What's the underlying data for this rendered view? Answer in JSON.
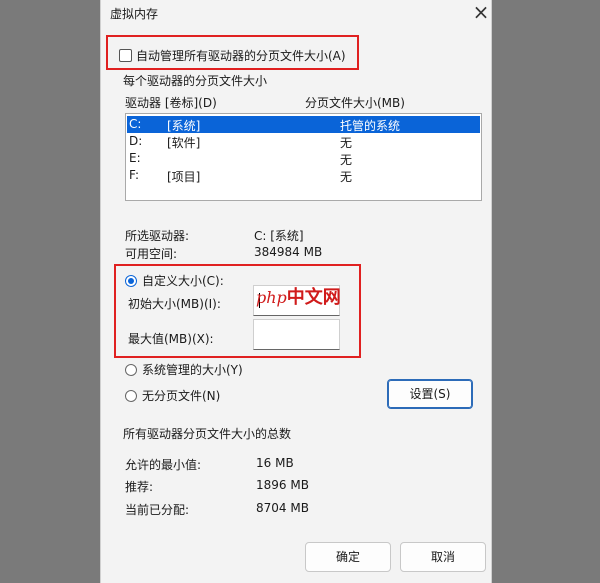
{
  "window": {
    "title": "虚拟内存"
  },
  "auto_manage": {
    "label": "自动管理所有驱动器的分页文件大小(A)",
    "checked": false
  },
  "per_drive": {
    "legend": "每个驱动器的分页文件大小",
    "col_drive": "驱动器 [卷标](D)",
    "col_size": "分页文件大小(MB)",
    "rows": [
      {
        "drive": "C:",
        "label": "[系统]",
        "size": "托管的系统",
        "selected": true
      },
      {
        "drive": "D:",
        "label": "[软件]",
        "size": "无",
        "selected": false
      },
      {
        "drive": "E:",
        "label": "",
        "size": "无",
        "selected": false
      },
      {
        "drive": "F:",
        "label": "[项目]",
        "size": "无",
        "selected": false
      }
    ],
    "selected_drive_label": "所选驱动器:",
    "selected_drive_value": "C:  [系统]",
    "free_space_label": "可用空间:",
    "free_space_value": "384984 MB"
  },
  "custom": {
    "label": "自定义大小(C):",
    "initial_label": "初始大小(MB)(I):",
    "initial_value": "",
    "max_label": "最大值(MB)(X):",
    "max_value": ""
  },
  "system_managed": {
    "label": "系统管理的大小(Y)"
  },
  "no_paging": {
    "label": "无分页文件(N)"
  },
  "set_button": "设置(S)",
  "totals": {
    "legend": "所有驱动器分页文件大小的总数",
    "min_label": "允许的最小值:",
    "min_value": "16 MB",
    "rec_label": "推荐:",
    "rec_value": "1896 MB",
    "cur_label": "当前已分配:",
    "cur_value": "8704 MB"
  },
  "ok_button": "确定",
  "cancel_button": "取消",
  "watermark": {
    "php": "php",
    "cn": "中文网"
  },
  "colors": {
    "accent": "#0a64d8",
    "highlight": "#e02020"
  }
}
